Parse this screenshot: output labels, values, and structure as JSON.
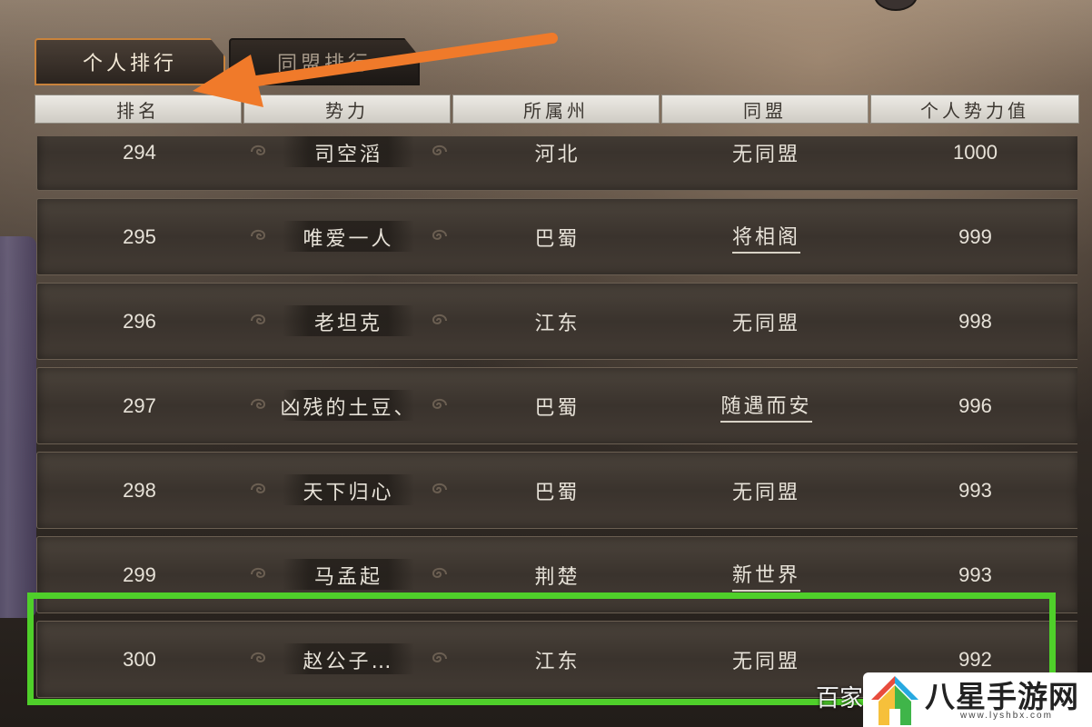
{
  "tabs": [
    {
      "label": "个人排行",
      "active": true
    },
    {
      "label": "同盟排行",
      "active": false
    }
  ],
  "columns": [
    "排名",
    "势力",
    "所属州",
    "同盟",
    "个人势力值"
  ],
  "rows": [
    {
      "rank": "294",
      "name": "司空滔",
      "state": "河北",
      "alliance": "无同盟",
      "alliance_link": false,
      "value": "1000"
    },
    {
      "rank": "295",
      "name": "唯爱一人",
      "state": "巴蜀",
      "alliance": "将相阁",
      "alliance_link": true,
      "value": "999"
    },
    {
      "rank": "296",
      "name": "老坦克",
      "state": "江东",
      "alliance": "无同盟",
      "alliance_link": false,
      "value": "998"
    },
    {
      "rank": "297",
      "name": "凶残的土豆、",
      "state": "巴蜀",
      "alliance": "随遇而安",
      "alliance_link": true,
      "value": "996"
    },
    {
      "rank": "298",
      "name": "天下归心",
      "state": "巴蜀",
      "alliance": "无同盟",
      "alliance_link": false,
      "value": "993"
    },
    {
      "rank": "299",
      "name": "马孟起",
      "state": "荆楚",
      "alliance": "新世界",
      "alliance_link": true,
      "value": "993"
    },
    {
      "rank": "300",
      "name": "赵公子…",
      "state": "江东",
      "alliance": "无同盟",
      "alliance_link": false,
      "value": "992"
    }
  ],
  "annotations": {
    "arrow_color": "#f07a2a",
    "highlight_color": "#4fcf2a"
  },
  "watermark": {
    "left_text": "百家",
    "brand": "八星手游网",
    "url": "www.lyshbx.com"
  },
  "colors": {
    "tab_active_border": "#c9833c",
    "header_bg": "#dcd9d2",
    "row_text": "#e7e2d8"
  }
}
